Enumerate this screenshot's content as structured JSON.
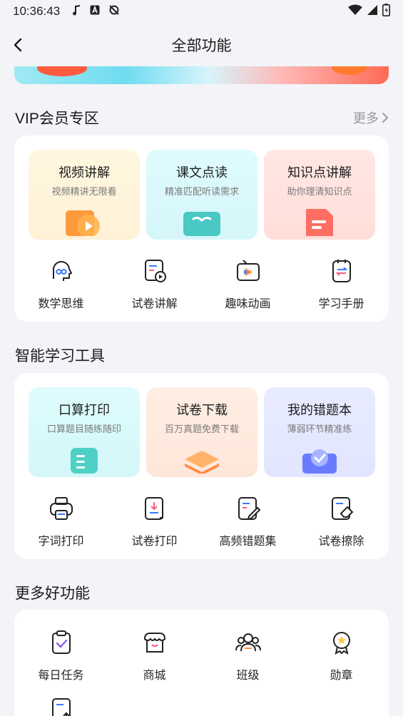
{
  "status_bar": {
    "time": "10:36:43"
  },
  "nav": {
    "title": "全部功能"
  },
  "vip": {
    "title": "VIP会员专区",
    "more": "更多",
    "tiles": [
      {
        "title": "视频讲解",
        "subtitle": "视频精讲无限看"
      },
      {
        "title": "课文点读",
        "subtitle": "精准匹配听读需求"
      },
      {
        "title": "知识点讲解",
        "subtitle": "助你理清知识点"
      }
    ],
    "grid": [
      {
        "label": "数学思维",
        "icon": "infinity-head-icon"
      },
      {
        "label": "试卷讲解",
        "icon": "paper-play-icon"
      },
      {
        "label": "趣味动画",
        "icon": "tv-play-icon"
      },
      {
        "label": "学习手册",
        "icon": "handbook-icon"
      }
    ]
  },
  "tools": {
    "title": "智能学习工具",
    "tiles": [
      {
        "title": "口算打印",
        "subtitle": "口算题目随练随印"
      },
      {
        "title": "试卷下载",
        "subtitle": "百万真题免费下载"
      },
      {
        "title": "我的错题本",
        "subtitle": "薄弱环节精准练"
      }
    ],
    "grid": [
      {
        "label": "字词打印",
        "icon": "printer-icon"
      },
      {
        "label": "试卷打印",
        "icon": "paper-print-icon"
      },
      {
        "label": "高频错题集",
        "icon": "paper-edit-icon"
      },
      {
        "label": "试卷擦除",
        "icon": "eraser-icon"
      }
    ]
  },
  "more_features": {
    "title": "更多好功能",
    "grid": [
      {
        "label": "每日任务",
        "icon": "clipboard-check-icon"
      },
      {
        "label": "商城",
        "icon": "shop-icon"
      },
      {
        "label": "班级",
        "icon": "group-icon"
      },
      {
        "label": "勋章",
        "icon": "medal-icon"
      }
    ]
  },
  "colors": {
    "accent_blue": "#3a7bff",
    "accent_pink": "#ff5a7a",
    "tile_yellow": "#fff6dc",
    "tile_cyan": "#dcfbfd",
    "tile_pink": "#ffe6e3",
    "tile_orange": "#ffe9dc",
    "tile_lavender": "#e8ebff"
  }
}
